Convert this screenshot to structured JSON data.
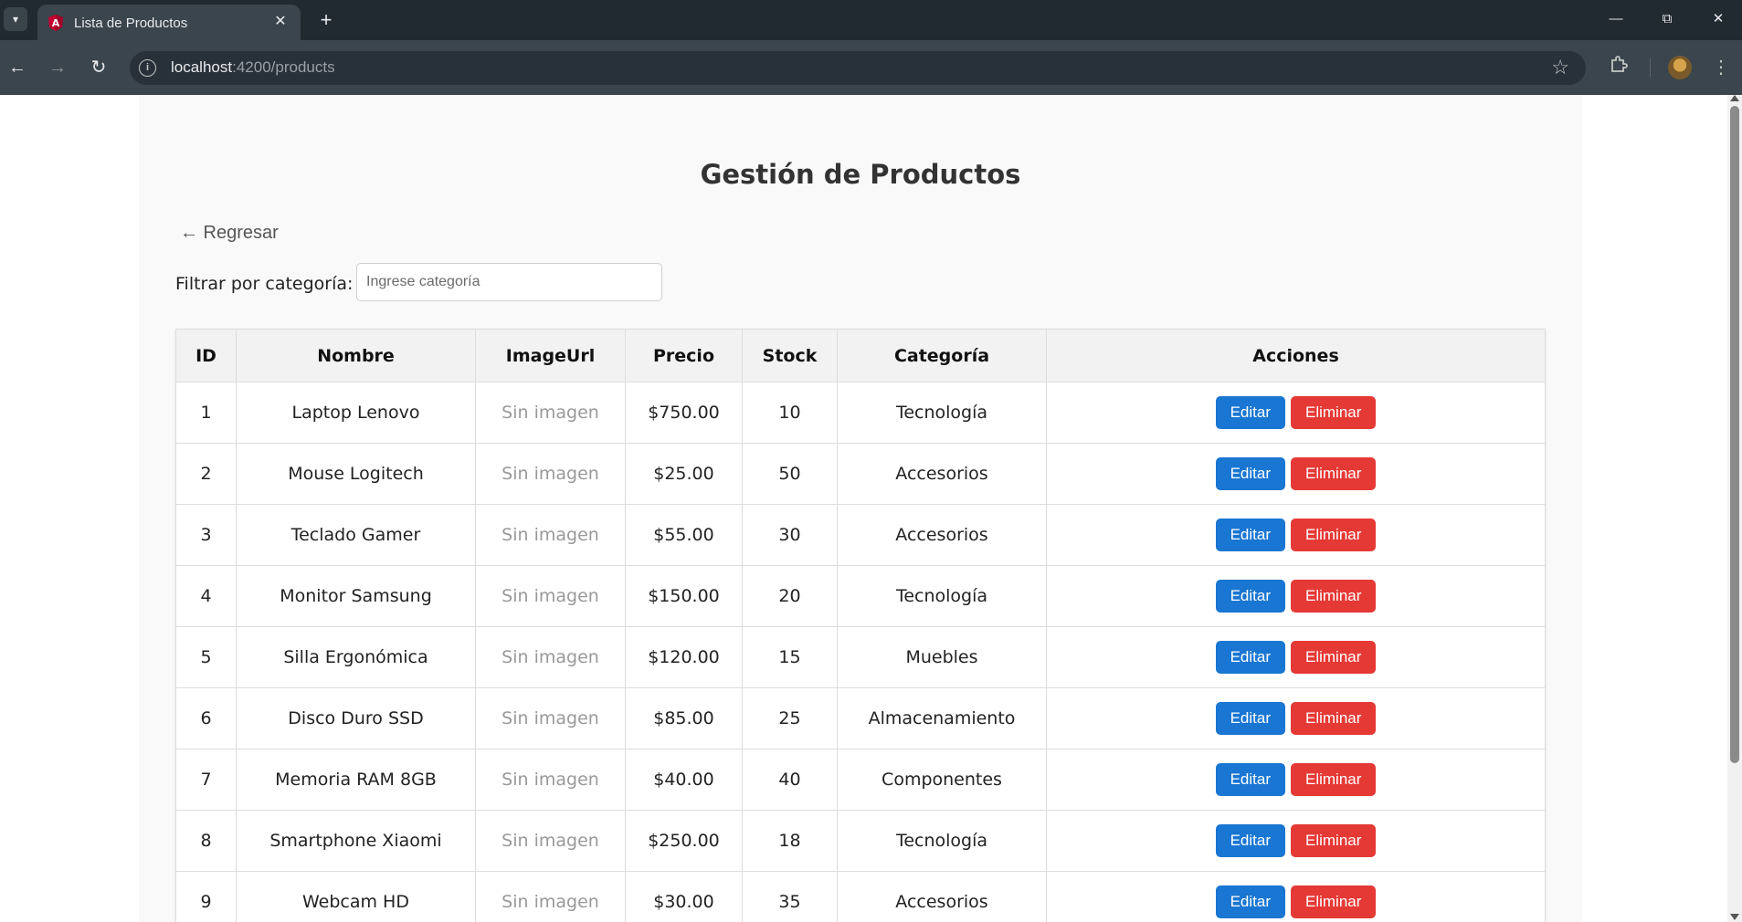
{
  "browser": {
    "tab_title": "Lista de Productos",
    "tab_close": "✕",
    "new_tab": "+",
    "url_host": "localhost",
    "url_path": ":4200/products",
    "icons": {
      "tab_list": "chevron-down-icon",
      "favicon": "angular-icon",
      "back": "arrow-left-icon",
      "forward": "arrow-right-icon",
      "reload": "reload-icon",
      "site_info": "info-icon",
      "bookmark": "star-icon",
      "extensions": "puzzle-icon",
      "menu": "kebab-menu-icon"
    }
  },
  "page": {
    "title": "Gestión de Productos",
    "back_link": "← Regresar",
    "filter_label": "Filtrar por categoría:",
    "filter_placeholder": "Ingrese categoría"
  },
  "table": {
    "headers": [
      "ID",
      "Nombre",
      "ImageUrl",
      "Precio",
      "Stock",
      "Categoría",
      "Acciones"
    ],
    "edit_label": "Editar",
    "delete_label": "Eliminar",
    "rows": [
      {
        "id": "1",
        "nombre": "Laptop Lenovo",
        "imagen": "Sin imagen",
        "precio": "$750.00",
        "stock": "10",
        "categoria": "Tecnología"
      },
      {
        "id": "2",
        "nombre": "Mouse Logitech",
        "imagen": "Sin imagen",
        "precio": "$25.00",
        "stock": "50",
        "categoria": "Accesorios"
      },
      {
        "id": "3",
        "nombre": "Teclado Gamer",
        "imagen": "Sin imagen",
        "precio": "$55.00",
        "stock": "30",
        "categoria": "Accesorios"
      },
      {
        "id": "4",
        "nombre": "Monitor Samsung",
        "imagen": "Sin imagen",
        "precio": "$150.00",
        "stock": "20",
        "categoria": "Tecnología"
      },
      {
        "id": "5",
        "nombre": "Silla Ergonómica",
        "imagen": "Sin imagen",
        "precio": "$120.00",
        "stock": "15",
        "categoria": "Muebles"
      },
      {
        "id": "6",
        "nombre": "Disco Duro SSD",
        "imagen": "Sin imagen",
        "precio": "$85.00",
        "stock": "25",
        "categoria": "Almacenamiento"
      },
      {
        "id": "7",
        "nombre": "Memoria RAM 8GB",
        "imagen": "Sin imagen",
        "precio": "$40.00",
        "stock": "40",
        "categoria": "Componentes"
      },
      {
        "id": "8",
        "nombre": "Smartphone Xiaomi",
        "imagen": "Sin imagen",
        "precio": "$250.00",
        "stock": "18",
        "categoria": "Tecnología"
      },
      {
        "id": "9",
        "nombre": "Webcam HD",
        "imagen": "Sin imagen",
        "precio": "$30.00",
        "stock": "35",
        "categoria": "Accesorios"
      }
    ]
  },
  "colors": {
    "edit_button": "#1976d2",
    "delete_button": "#e53935",
    "header_bg": "#f2f2f2"
  }
}
